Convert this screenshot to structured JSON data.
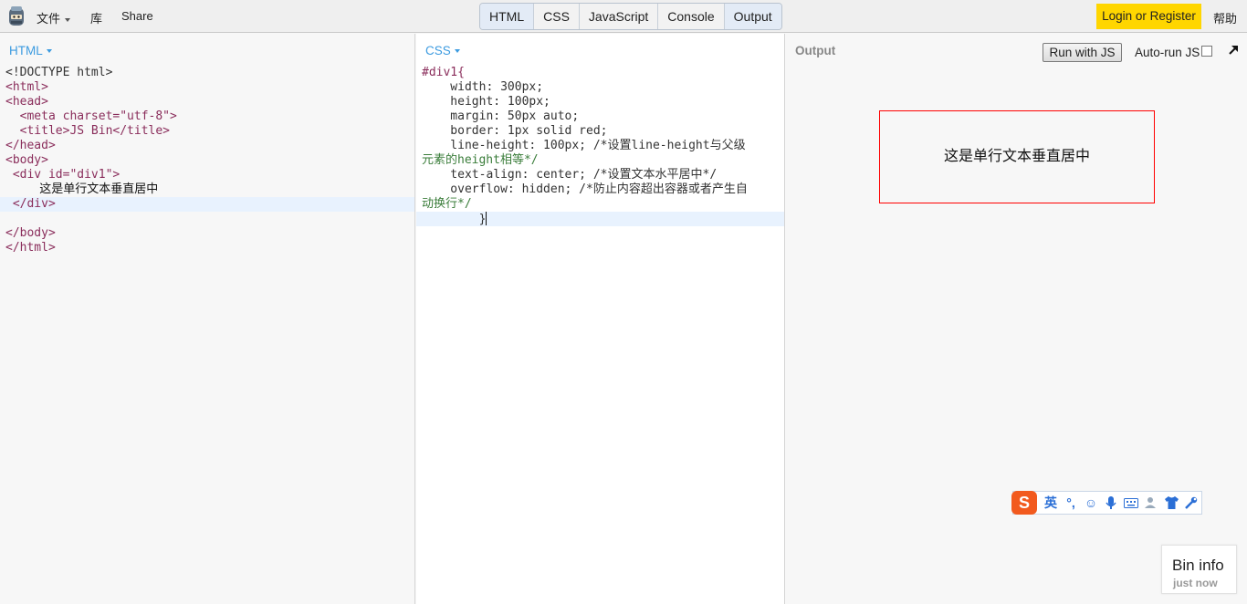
{
  "topbar": {
    "logo_icon": "jsbin-logo-icon",
    "menu": {
      "file": "文件",
      "library": "库",
      "share": "Share"
    },
    "tabs": [
      {
        "label": "HTML",
        "active": true
      },
      {
        "label": "CSS",
        "active": false
      },
      {
        "label": "JavaScript",
        "active": false
      },
      {
        "label": "Console",
        "active": false
      },
      {
        "label": "Output",
        "active": true
      }
    ],
    "login": "Login or Register",
    "help": "帮助",
    "login_color": "#ffd600"
  },
  "html_panel": {
    "label": "HTML",
    "lines": [
      "<!DOCTYPE html>",
      "<html>",
      "<head>",
      "  <meta charset=\"utf-8\">",
      "  <title>JS Bin</title>",
      "</head>",
      "<body>",
      " <div id=\"div1\">",
      "         这是单行文本垂直居中",
      " </div>",
      "",
      "</body>",
      "</html>"
    ]
  },
  "css_panel": {
    "label": "CSS",
    "lines": [
      "#div1{",
      "    width: 300px;",
      "    height: 100px;",
      "    margin: 50px auto;",
      "    border: 1px solid red;",
      "    line-height: 100px; /*设置line-height与父级",
      "元素的height相等*/",
      "    text-align: center; /*设置文本水平居中*/",
      "    overflow: hidden; /*防止内容超出容器或者产生自",
      "动换行*/",
      "        }"
    ]
  },
  "output_panel": {
    "label": "Output",
    "run_button": "Run with JS",
    "autorun_label": "Auto-run JS",
    "autorun_checked": false,
    "popout_icon": "popout-arrow-icon",
    "demo_text": "这是单行文本垂直居中",
    "demo_border_color": "#ff0000"
  },
  "ime_toolbar": {
    "logo": "S",
    "mode": "英",
    "items": [
      "punctuation-icon",
      "emoji-icon",
      "microphone-icon",
      "keyboard-icon",
      "user-icon",
      "skin-shirt-icon",
      "wrench-icon"
    ]
  },
  "bin_info": {
    "title": "Bin info",
    "subtitle": "just now"
  }
}
